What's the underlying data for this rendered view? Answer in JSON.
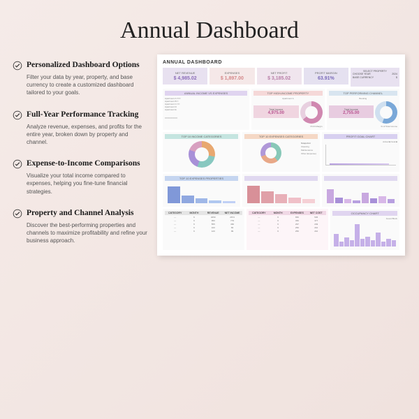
{
  "title": "Annual Dashboard",
  "features": [
    {
      "t": "Personalized Dashboard Options",
      "d": "Filter your data by year, property, and base currency to create a customized dashboard tailored to your goals."
    },
    {
      "t": "Full-Year Performance Tracking",
      "d": "Analyze revenue, expenses, and profits for the entire year, broken down by property and channel."
    },
    {
      "t": "Expense-to-Income Comparisons",
      "d": "Visualize your total income compared to expenses, helping you fine-tune financial strategies."
    },
    {
      "t": "Property and Channel Analysis",
      "d": "Discover the best-performing properties and channels to maximize profitability and refine your business approach."
    }
  ],
  "dash": {
    "title": "ANNUAL DASHBOARD",
    "kpi": {
      "rev_l": "NET REVENUE",
      "rev_v": "$ 4,985.02",
      "exp_l": "EXPENSES",
      "exp_v": "$ 1,897.00",
      "np_l": "NET PROFIT",
      "np_v": "$ 3,185.02",
      "pm_l": "PROFIT MARGIN",
      "pm_v": "63.91%"
    },
    "filters": {
      "h": "SELECT PROPERTY",
      "y": "CHOOSE YEAR",
      "yv": "2024",
      "c": "BASE CURRENCY",
      "cv": "$"
    },
    "cards": {
      "monthly": "ANNUAL INCOME VS EXPENSES",
      "top_inc": "TOP HIGH-INCOME PROPERTY",
      "top_inc_name": "Apartment A",
      "ti_l": "Total Income",
      "ti_v": "4,975.00",
      "pb_l": "Profit Margin",
      "pb_v": "63.91%",
      "booking": "Booking",
      "tn_l": "Total Income",
      "tn_v": "2,755.00",
      "bp_l": "% of Total Income",
      "bp_v": "55.27%",
      "channel": "TOP PERFORMING CHANNEL",
      "inc_ch": "TOP 10 INCOME CATEGORIES",
      "exp_ch": "TOP 10 EXPENSES CATEGORIES",
      "snap": "Snapshot",
      "snap_items": [
        "Cleaning",
        "Maintenance",
        "Other (Expense)"
      ],
      "goal": "PROFIT GOAL CHART",
      "goal_a": "Actual",
      "goal_g": "Goal",
      "exp_prop": "TOP 10 EXPENSES PROPERTIES",
      "cat_h": [
        "CATEGORY",
        "MONTH",
        "REVENUE",
        "NET INCOME"
      ],
      "prop_h": [
        "CATEGORY",
        "MONTH",
        "EXPENSES",
        "NET COST"
      ],
      "occ": "OCCUPANCY CHART",
      "occ_leg": "Guest    Block"
    }
  }
}
